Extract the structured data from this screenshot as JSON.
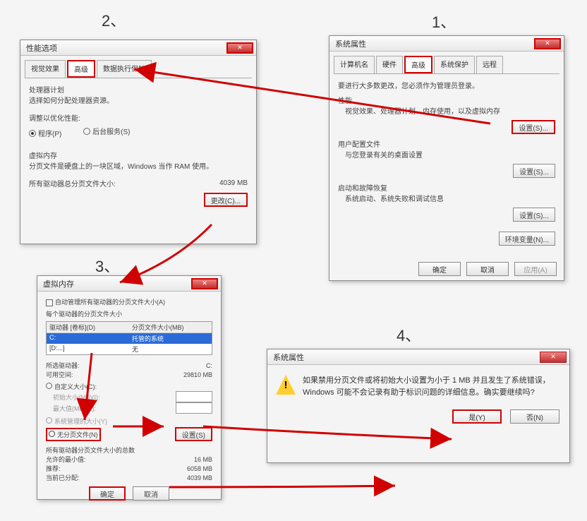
{
  "steps": {
    "s1": "1、",
    "s2": "2、",
    "s3": "3、",
    "s4": "4、"
  },
  "dlg1": {
    "title": "系统属性",
    "tabs": [
      "计算机名",
      "硬件",
      "高级",
      "系统保护",
      "远程"
    ],
    "line1": "要进行大多数更改，您必须作为管理员登录。",
    "perf_title": "性能",
    "perf_desc": "视觉效果、处理器计划、内存使用，以及虚拟内存",
    "btn_settings": "设置(S)...",
    "user_title": "用户配置文件",
    "user_desc": "与您登录有关的桌面设置",
    "start_title": "启动和故障恢复",
    "start_desc": "系统启动、系统失败和调试信息",
    "btn_env": "环境变量(N)...",
    "ok": "确定",
    "cancel": "取消",
    "apply": "应用(A)"
  },
  "dlg2": {
    "title": "性能选项",
    "tabs": [
      "视觉效果",
      "高级",
      "数据执行保护"
    ],
    "proc_title": "处理器计划",
    "proc_desc": "选择如何分配处理器资源。",
    "adjust": "调整以优化性能:",
    "r_prog": "程序(P)",
    "r_bg": "后台服务(S)",
    "vm_title": "虚拟内存",
    "vm_desc": "分页文件是硬盘上的一块区域，Windows 当作 RAM 使用。",
    "vm_total_lbl": "所有驱动器总分页文件大小:",
    "vm_total_val": "4039 MB",
    "btn_change": "更改(C)..."
  },
  "dlg3": {
    "title": "虚拟内存",
    "auto_chk": "自动管理所有驱动器的分页文件大小(A)",
    "each_lbl": "每个驱动器的分页文件大小",
    "col1": "驱动器 [卷标](D)",
    "col2": "分页文件大小(MB)",
    "row_sel_a": "C:",
    "row_sel_b": "托管的系统",
    "row2_a": "[D:...]",
    "row2_b": "无",
    "sel_drive_lbl": "所选驱动器:",
    "sel_drive_val": "C:",
    "avail_lbl": "可用空间:",
    "avail_val": "29810 MB",
    "r_custom": "自定义大小(C):",
    "init_lbl": "初始大小(MB)(I):",
    "max_lbl": "最大值(MB)(X):",
    "r_sys": "系统管理的大小(Y)",
    "r_none": "无分页文件(N)",
    "btn_set": "设置(S)",
    "rec_title": "所有驱动器分页文件大小的总数",
    "min_lbl": "允许的最小值:",
    "min_val": "16 MB",
    "rec_lbl": "推荐:",
    "rec_val": "6058 MB",
    "cur_lbl": "当前已分配:",
    "cur_val": "4039 MB",
    "ok": "确定",
    "cancel": "取消"
  },
  "dlg4": {
    "title": "系统属性",
    "msg": "如果禁用分页文件或将初始大小设置为小于 1 MB 并且发生了系统错误，Windows 可能不会记录有助于标识问题的详细信息。确实要继续吗?",
    "yes": "是(Y)",
    "no": "否(N)"
  }
}
